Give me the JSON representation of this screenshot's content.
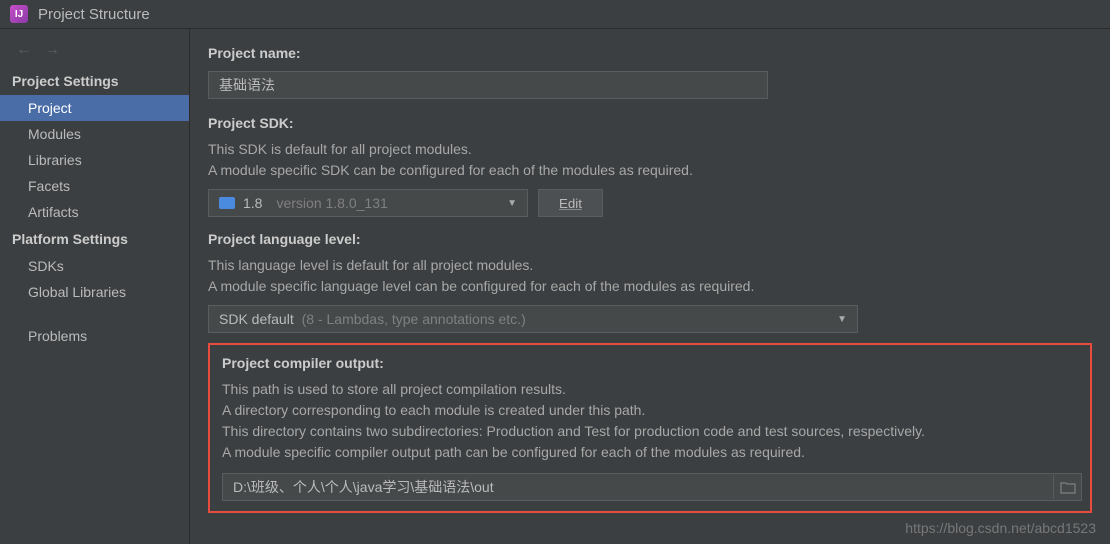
{
  "window": {
    "title": "Project Structure"
  },
  "sidebar": {
    "heading1": "Project Settings",
    "items1": [
      {
        "label": "Project",
        "selected": true
      },
      {
        "label": "Modules"
      },
      {
        "label": "Libraries"
      },
      {
        "label": "Facets"
      },
      {
        "label": "Artifacts"
      }
    ],
    "heading2": "Platform Settings",
    "items2": [
      {
        "label": "SDKs"
      },
      {
        "label": "Global Libraries"
      }
    ],
    "items3": [
      {
        "label": "Problems"
      }
    ]
  },
  "main": {
    "projectName": {
      "label": "Project name:",
      "value": "基础语法"
    },
    "projectSdk": {
      "label": "Project SDK:",
      "desc1": "This SDK is default for all project modules.",
      "desc2": "A module specific SDK can be configured for each of the modules as required.",
      "selectedMain": "1.8",
      "selectedSub": "version 1.8.0_131",
      "editLabel": "Edit"
    },
    "langLevel": {
      "label": "Project language level:",
      "desc1": "This language level is default for all project modules.",
      "desc2": "A module specific language level can be configured for each of the modules as required.",
      "selectedMain": "SDK default",
      "selectedSub": "(8 - Lambdas, type annotations etc.)"
    },
    "compilerOutput": {
      "label": "Project compiler output:",
      "desc1": "This path is used to store all project compilation results.",
      "desc2": "A directory corresponding to each module is created under this path.",
      "desc3": "This directory contains two subdirectories: Production and Test for production code and test sources, respectively.",
      "desc4": "A module specific compiler output path can be configured for each of the modules as required.",
      "path": "D:\\班级、个人\\个人\\java学习\\基础语法\\out"
    }
  },
  "watermark": "https://blog.csdn.net/abcd1523"
}
